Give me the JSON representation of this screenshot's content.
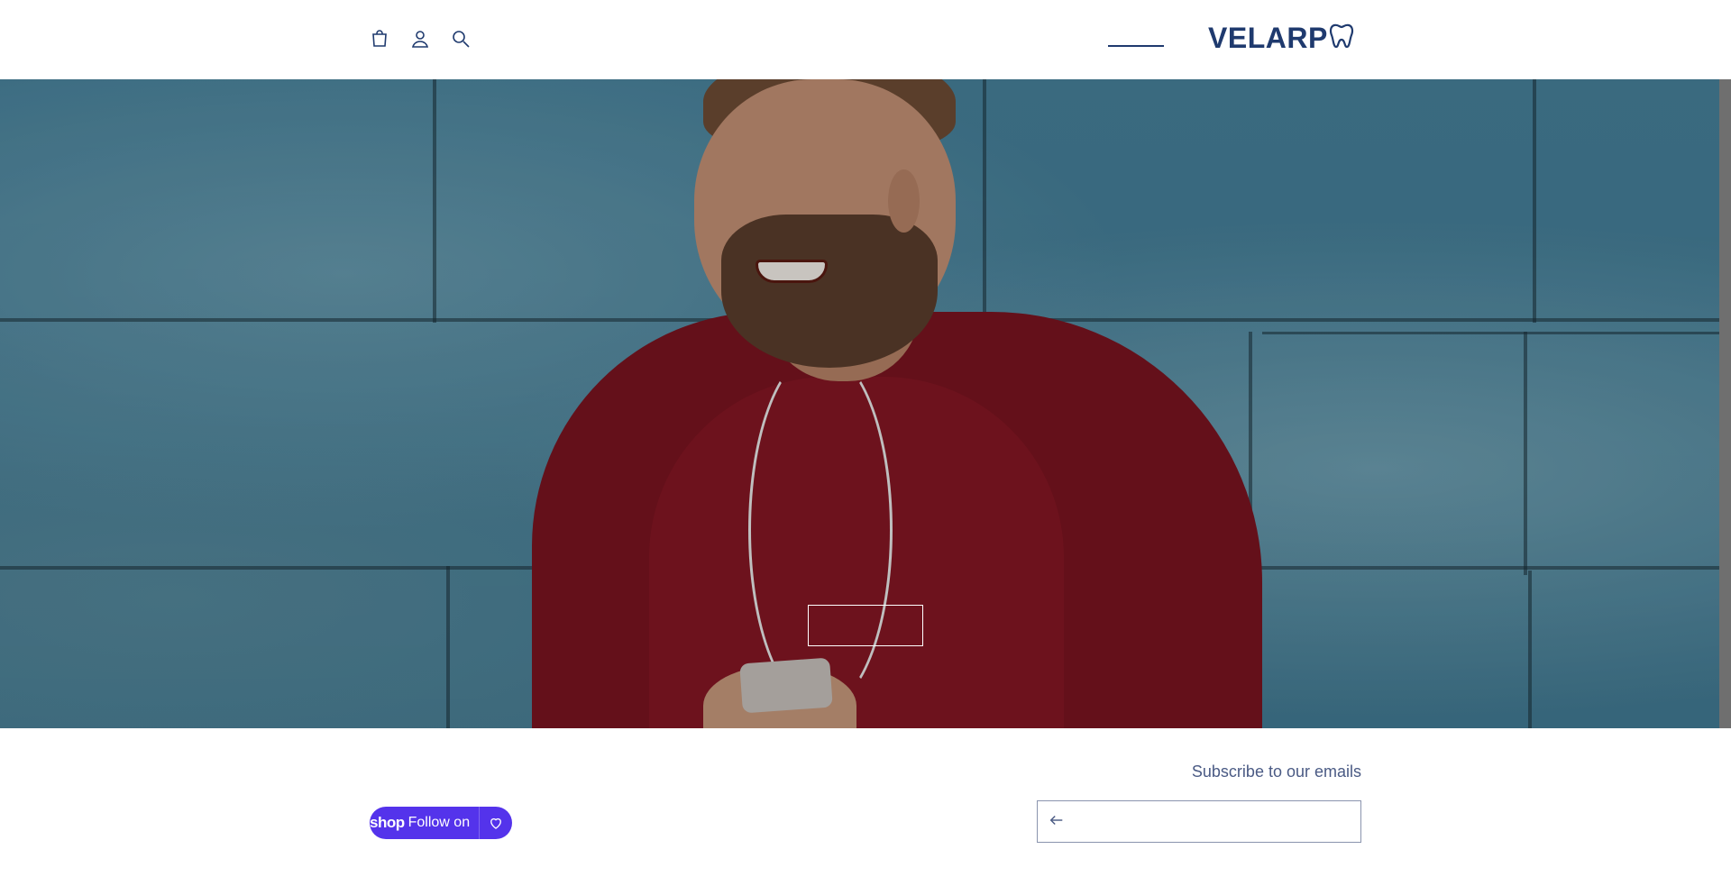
{
  "header": {
    "icons": [
      "cart-icon",
      "account-icon",
      "search-icon"
    ],
    "logo_text": "VELARP",
    "logo_icon": "tooth-icon",
    "brand_color": "#1f3a6e"
  },
  "hero": {
    "button_label": "",
    "scene": "man in red sweater with earphones against blue brick wall"
  },
  "footer": {
    "subscribe_title": "Subscribe to our emails",
    "email_placeholder": "",
    "submit_icon": "arrow-left-icon",
    "shop_follow": {
      "logo": "shop",
      "label": "Follow on",
      "icon": "heart-icon",
      "color": "#5433eb"
    }
  }
}
